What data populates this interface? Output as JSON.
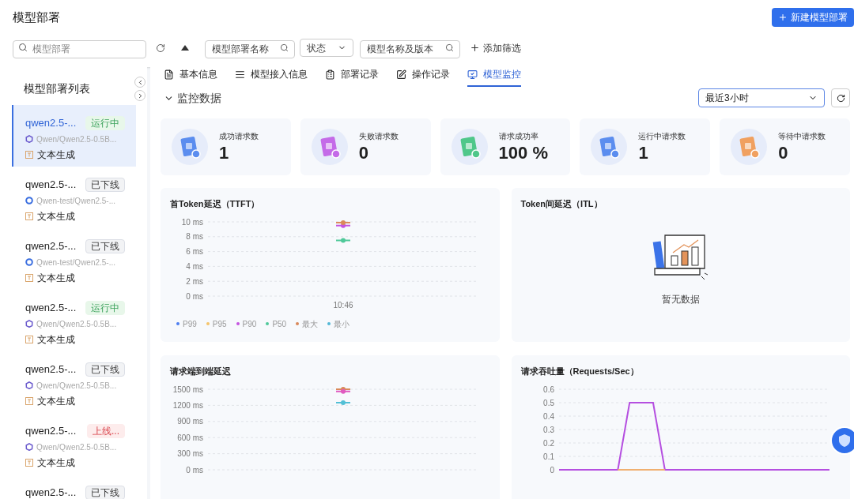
{
  "header": {
    "title": "模型部署",
    "new_button": "新建模型部署"
  },
  "filters": {
    "search_placeholder": "模型部署",
    "name_placeholder": "模型部署名称",
    "status_placeholder": "状态",
    "model_placeholder": "模型名称及版本",
    "add_filter": "添加筛选"
  },
  "sidebar": {
    "title": "模型部署列表",
    "items": [
      {
        "name": "qwen2.5-...",
        "status": {
          "label": "运行中",
          "kind": "running"
        },
        "model": {
          "label": "Qwen/Qwen2.5-0.5B...",
          "kind": "hexagon"
        },
        "task": "文本生成",
        "selected": true
      },
      {
        "name": "qwen2.5-...",
        "status": {
          "label": "已下线",
          "kind": "offline"
        },
        "model": {
          "label": "Qwen-test/Qwen2.5-...",
          "kind": "ring"
        },
        "task": "文本生成",
        "selected": false
      },
      {
        "name": "qwen2.5-...",
        "status": {
          "label": "已下线",
          "kind": "offline"
        },
        "model": {
          "label": "Qwen-test/Qwen2.5-...",
          "kind": "ring"
        },
        "task": "文本生成",
        "selected": false
      },
      {
        "name": "qwen2.5-...",
        "status": {
          "label": "运行中",
          "kind": "running"
        },
        "model": {
          "label": "Qwen/Qwen2.5-0.5B...",
          "kind": "hexagon"
        },
        "task": "文本生成",
        "selected": false
      },
      {
        "name": "qwen2.5-...",
        "status": {
          "label": "已下线",
          "kind": "offline"
        },
        "model": {
          "label": "Qwen/Qwen2.5-0.5B...",
          "kind": "hexagon"
        },
        "task": "文本生成",
        "selected": false
      },
      {
        "name": "qwen2.5-...",
        "status": {
          "label": "上线...",
          "kind": "failed"
        },
        "model": {
          "label": "Qwen/Qwen2.5-0.5B...",
          "kind": "hexagon"
        },
        "task": "文本生成",
        "selected": false
      },
      {
        "name": "qwen2.5-...",
        "status": {
          "label": "已下线",
          "kind": "offline"
        },
        "selected": false
      }
    ]
  },
  "tabs": [
    {
      "label": "基本信息",
      "selected": false
    },
    {
      "label": "模型接入信息",
      "selected": false
    },
    {
      "label": "部署记录",
      "selected": false
    },
    {
      "label": "操作记录",
      "selected": false
    },
    {
      "label": "模型监控",
      "selected": true
    }
  ],
  "section": {
    "title": "监控数据",
    "expanded": true,
    "range": "最近3小时"
  },
  "stats": [
    {
      "label": "成功请求数",
      "value": "1",
      "color": "#5b8def"
    },
    {
      "label": "失败请求数",
      "value": "0",
      "color": "#c46be8"
    },
    {
      "label": "请求成功率",
      "value": "100 %",
      "color": "#4fc78a"
    },
    {
      "label": "运行中请求数",
      "value": "1",
      "color": "#5b8def"
    },
    {
      "label": "等待中请求数",
      "value": "0",
      "color": "#f0a060"
    }
  ],
  "charts": [
    {
      "kind": "chart",
      "chart_data": {
        "type": "line",
        "title": "首Token延迟（TTFT）",
        "categories": [
          "10:46"
        ],
        "grid": true,
        "ylim": [
          0,
          10
        ],
        "yticks": [
          {
            "value": 0,
            "label": "0 ms"
          },
          {
            "value": 2,
            "label": "2 ms"
          },
          {
            "value": 4,
            "label": "4 ms"
          },
          {
            "value": 6,
            "label": "6 ms"
          },
          {
            "value": 8,
            "label": "8 ms"
          },
          {
            "value": 10,
            "label": "10 ms"
          }
        ],
        "series": [
          {
            "name": "P99",
            "color": "#4e7ff0",
            "values": [
              null
            ]
          },
          {
            "name": "P95",
            "color": "#f5c56b",
            "values": [
              null
            ]
          },
          {
            "name": "P90",
            "color": "#c454e0",
            "marker": "circle",
            "values": [
              9.5
            ]
          },
          {
            "name": "P50",
            "color": "#4fc99a",
            "marker": "circle",
            "values": [
              7.5
            ]
          },
          {
            "name": "最大",
            "color": "#d9895a",
            "marker": "circle",
            "values": [
              9.9
            ]
          },
          {
            "name": "最小",
            "color": "#53b8d6",
            "values": [
              null
            ]
          }
        ]
      }
    },
    {
      "kind": "empty",
      "title": "Token间延迟（ITL）",
      "message": "暂无数据"
    },
    {
      "kind": "chart",
      "chart_data": {
        "type": "line",
        "title": "请求端到端延迟",
        "grid": true,
        "ylim": [
          0,
          1500
        ],
        "yticks": [
          {
            "value": 0,
            "label": "0 ms"
          },
          {
            "value": 300,
            "label": "300 ms"
          },
          {
            "value": 600,
            "label": "600 ms"
          },
          {
            "value": 900,
            "label": "900 ms"
          },
          {
            "value": 1200,
            "label": "1200 ms"
          },
          {
            "value": 1500,
            "label": "1500 ms"
          }
        ],
        "series": [
          {
            "color": "#d9895a",
            "marker": "circle",
            "values": [
              1500
            ]
          },
          {
            "color": "#e05ac0",
            "marker": "circle",
            "values": [
              1460
            ]
          },
          {
            "color": "#53c0d6",
            "marker": "circle",
            "values": [
              1250
            ]
          }
        ]
      }
    },
    {
      "kind": "chart",
      "chart_data": {
        "type": "line",
        "title": "请求吞吐量（Requests/Sec）",
        "grid": true,
        "ylim": [
          0,
          0.6
        ],
        "yticks": [
          {
            "value": 0,
            "label": "0"
          },
          {
            "value": 0.1,
            "label": "0.1"
          },
          {
            "value": 0.2,
            "label": "0.2"
          },
          {
            "value": 0.3,
            "label": "0.3"
          },
          {
            "value": 0.4,
            "label": "0.4"
          },
          {
            "value": 0.5,
            "label": "0.5"
          },
          {
            "value": 0.6,
            "label": "0.6"
          }
        ],
        "series": [
          {
            "color": "#b54fe0",
            "values": [
              0,
              0,
              0,
              0,
              0,
              0,
              0.5,
              0.5,
              0.5,
              0,
              0,
              0,
              0,
              0,
              0,
              0,
              0,
              0,
              0,
              0,
              0,
              0,
              0,
              0
            ]
          },
          {
            "color": "#f0b070",
            "values": [
              null,
              null,
              null,
              null,
              null,
              0,
              0,
              0,
              0,
              0,
              null,
              null,
              null,
              null,
              null,
              null,
              null,
              null,
              null,
              null,
              null,
              null,
              null,
              null
            ]
          }
        ]
      }
    }
  ]
}
